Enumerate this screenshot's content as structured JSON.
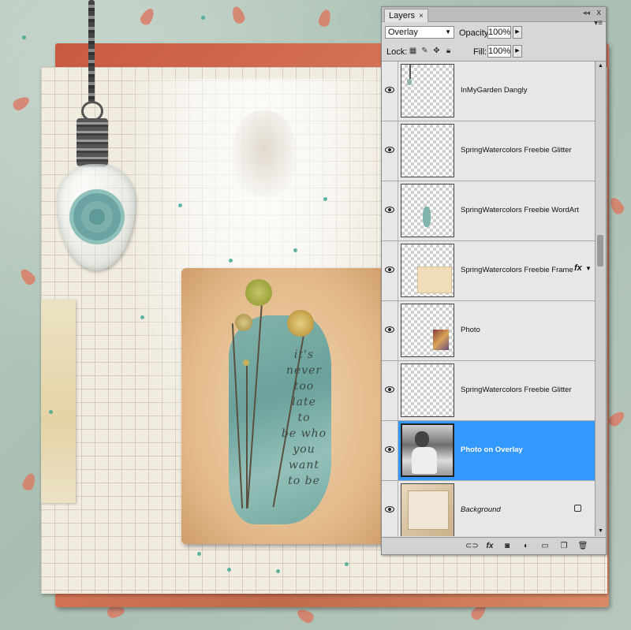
{
  "panel": {
    "tab_label": "Layers",
    "tab_close": "×",
    "collapse_glyph": "◂◂",
    "close_glyph": "x",
    "menu_glyph": "▾≡",
    "blend_mode": "Overlay",
    "opacity_label": "Opacity:",
    "opacity_value": "100%",
    "lock_label": "Lock:",
    "fill_label": "Fill:",
    "fill_value": "100%"
  },
  "layers": [
    {
      "name": "InMyGarden Dangly",
      "visible": true,
      "selected": false,
      "thumb": "dangly-thumb"
    },
    {
      "name": "SpringWatercolors Freebie Glitter",
      "visible": true,
      "selected": false,
      "thumb": "empty-thumb"
    },
    {
      "name": "SpringWatercolors Freebie WordArt",
      "visible": true,
      "selected": false,
      "thumb": "wordart-thumb"
    },
    {
      "name": "SpringWatercolors Freebie Frame",
      "visible": true,
      "selected": false,
      "thumb": "frame-thumb",
      "fx": "fx"
    },
    {
      "name": "Photo",
      "visible": true,
      "selected": false,
      "thumb": "photo-thumb"
    },
    {
      "name": "SpringWatercolors Freebie Glitter",
      "visible": true,
      "selected": false,
      "thumb": "empty-thumb"
    },
    {
      "name": "Photo on Overlay",
      "visible": true,
      "selected": true,
      "thumb": "bw-photo-thumb"
    },
    {
      "name": "Background",
      "visible": true,
      "selected": false,
      "thumb": "background-thumb",
      "italic": true,
      "locked": true
    }
  ],
  "wordart": {
    "lines": [
      "it's",
      "never",
      "too",
      "late",
      "to",
      "be who",
      "you",
      "want",
      "to be"
    ]
  },
  "colors": {
    "selection": "#3399ff",
    "panel_bg": "#d7d7d7",
    "mat_red": "#c85a42",
    "watercolor_teal": "#6aa8a3"
  },
  "icons": {
    "link": "link-icon",
    "fx": "fx-icon",
    "mask": "mask-icon",
    "adjustment": "adjustment-icon",
    "group": "folder-icon",
    "new": "new-layer-icon",
    "delete": "trash-icon"
  }
}
